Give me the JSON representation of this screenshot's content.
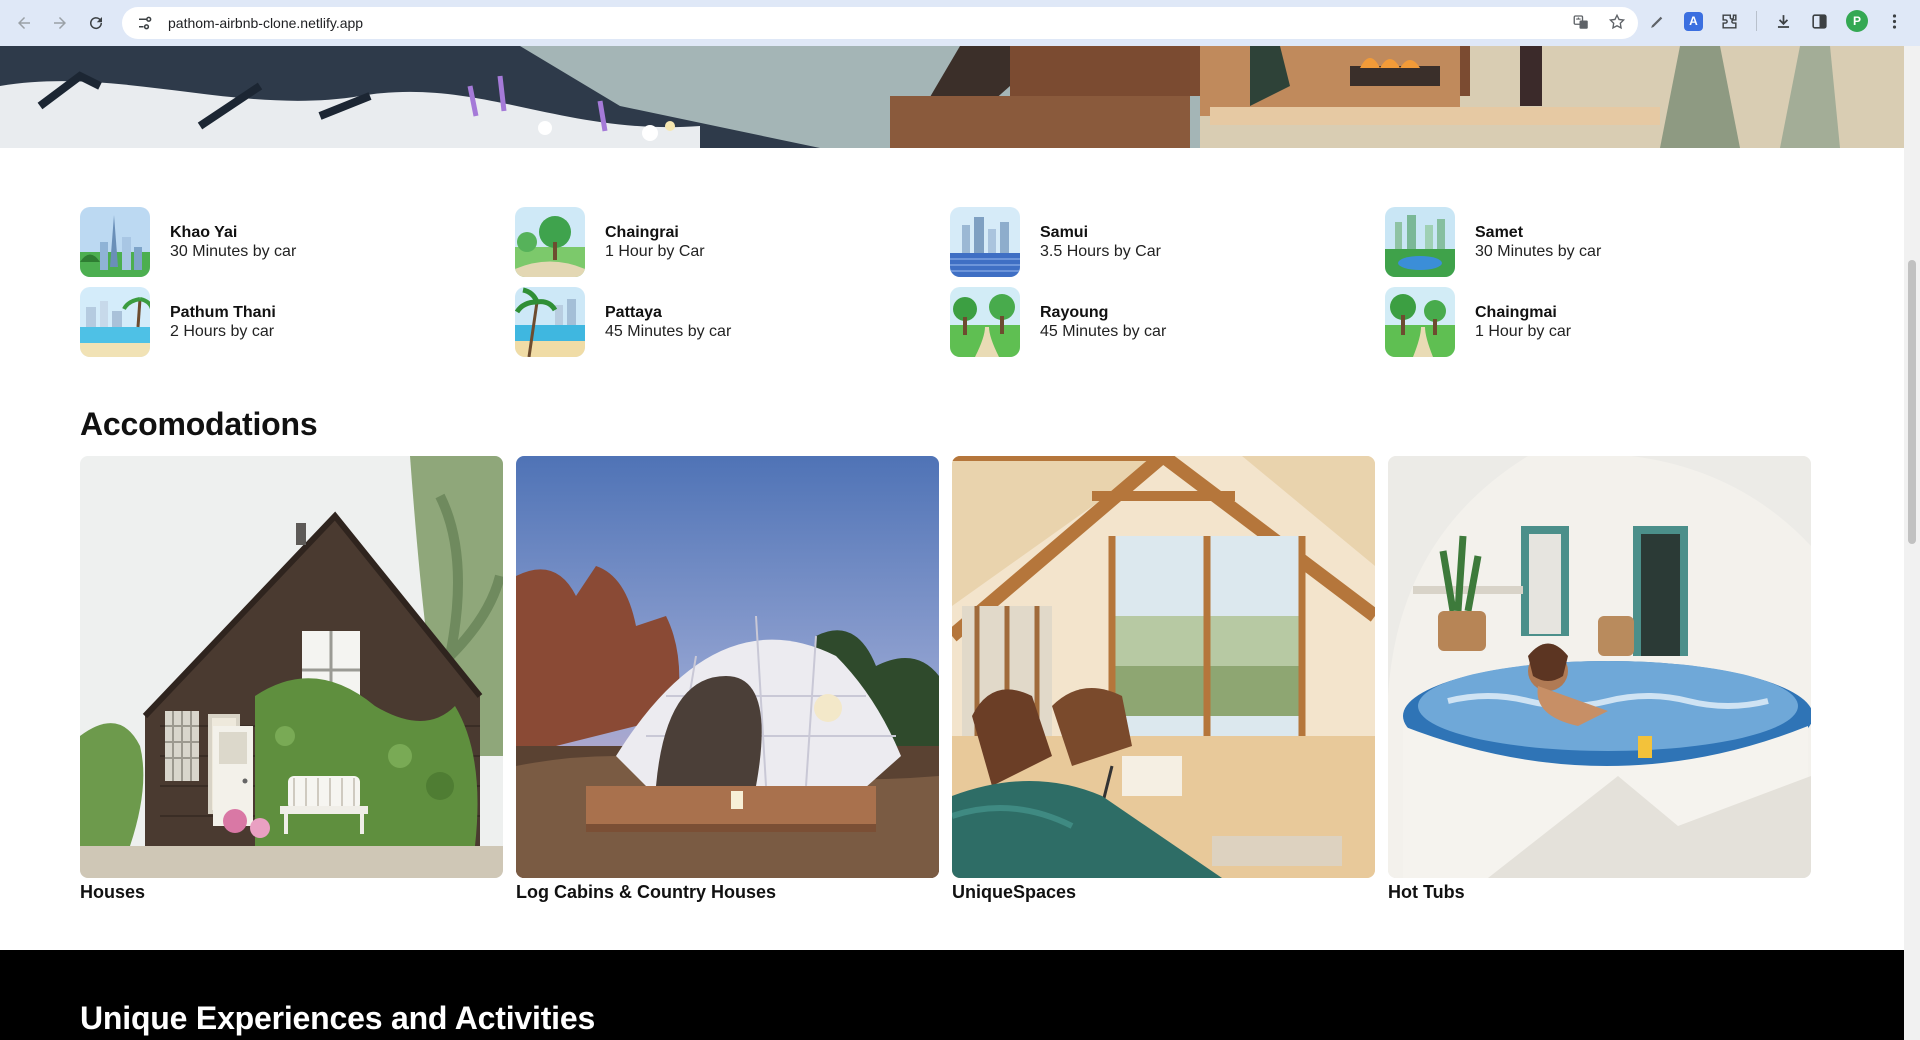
{
  "browser": {
    "url": "pathom-airbnb-clone.netlify.app",
    "profile_initial": "P",
    "extension_letter": "A"
  },
  "destinations": [
    {
      "name": "Khao Yai",
      "time": "30 Minutes by car",
      "icon": "city-tower-thumbnail"
    },
    {
      "name": "Chaingrai",
      "time": "1 Hour by Car",
      "icon": "park-thumbnail"
    },
    {
      "name": "Samui",
      "time": "3.5 Hours by Car",
      "icon": "waterfront-city-thumbnail"
    },
    {
      "name": "Samet",
      "time": "30 Minutes by car",
      "icon": "lake-city-thumbnail"
    },
    {
      "name": "Pathum Thani",
      "time": "2 Hours by car",
      "icon": "beach-city-thumbnail"
    },
    {
      "name": "Pattaya",
      "time": "45 Minutes by car",
      "icon": "palm-beach-thumbnail"
    },
    {
      "name": "Rayoung",
      "time": "45 Minutes by car",
      "icon": "park-path-thumbnail"
    },
    {
      "name": "Chaingmai",
      "time": "1 Hour by car",
      "icon": "park-path-thumbnail"
    }
  ],
  "accommodations": {
    "title": "Accomodations",
    "items": [
      {
        "label": "Houses"
      },
      {
        "label": "Log Cabins & Country Houses"
      },
      {
        "label": "UniqueSpaces"
      },
      {
        "label": "Hot Tubs"
      }
    ]
  },
  "experiences": {
    "title": "Unique Experiences and Activities"
  },
  "colors": {
    "chrome": "#dfe8f7",
    "dark_band": "#000000",
    "profile": "#34a853"
  }
}
